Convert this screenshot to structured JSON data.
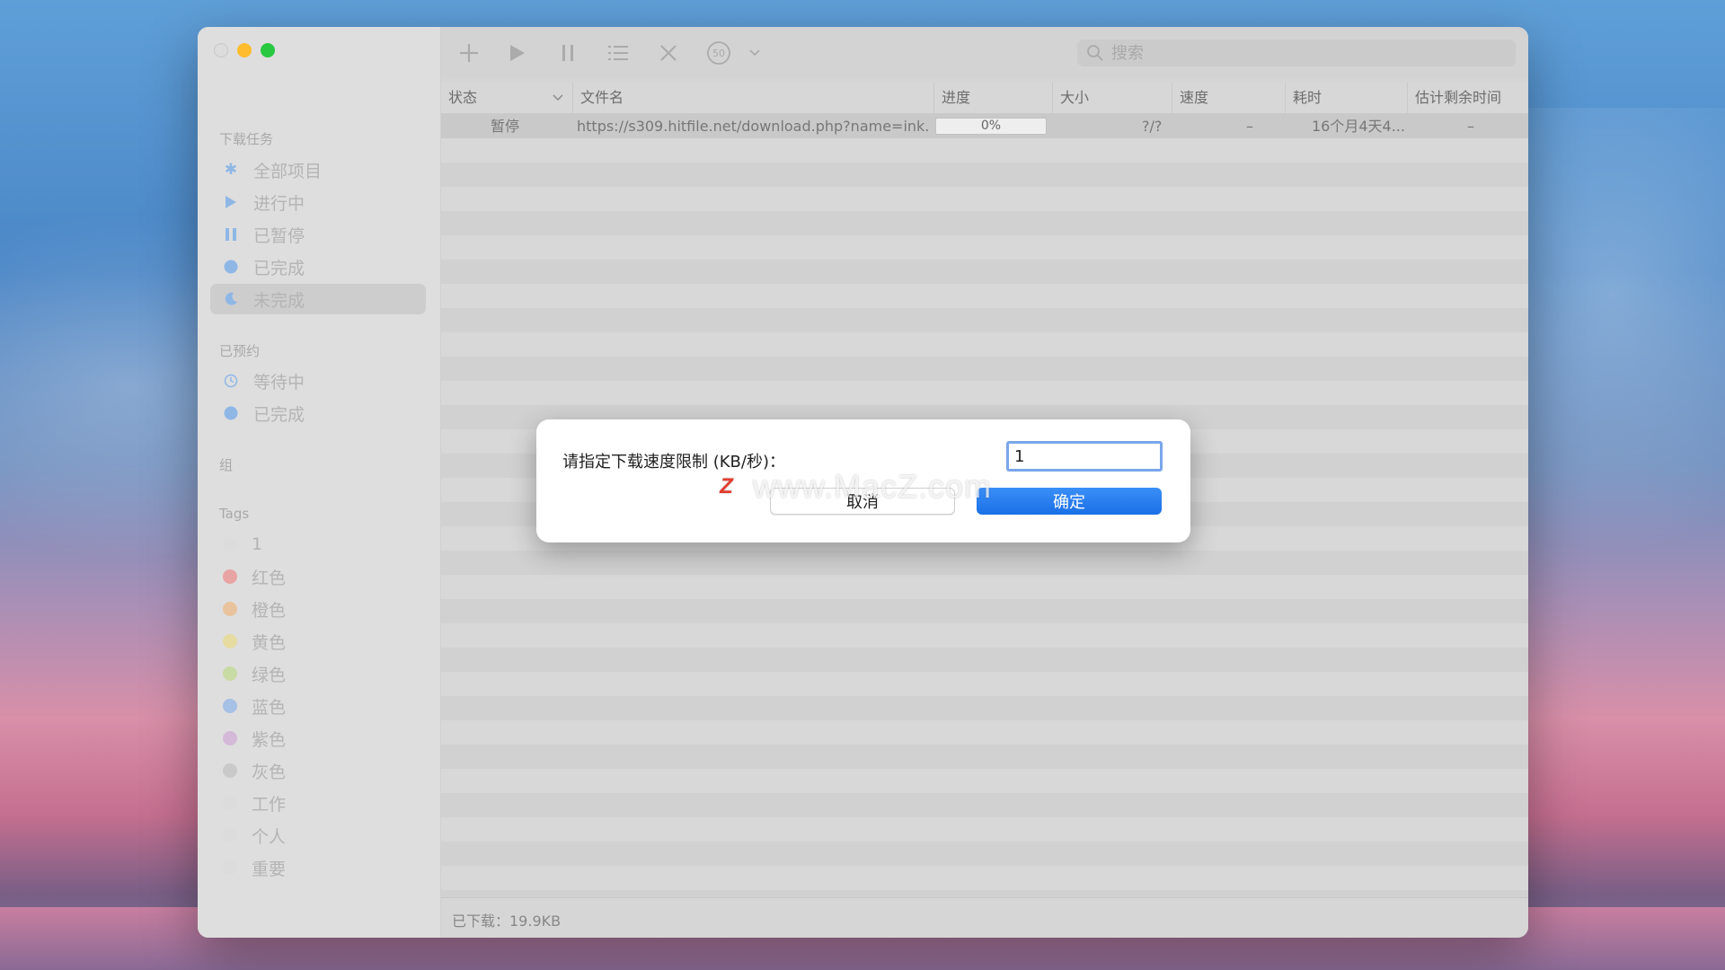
{
  "window": {
    "traffic_lights": [
      "close",
      "minimize",
      "maximize"
    ]
  },
  "sidebar": {
    "downloads": {
      "title": "下载任务",
      "items": [
        {
          "label": "全部项目",
          "icon": "asterisk-icon",
          "color": "#8fb7e6"
        },
        {
          "label": "进行中",
          "icon": "play-icon",
          "color": "#8fb7e6"
        },
        {
          "label": "已暂停",
          "icon": "pause-icon",
          "color": "#8fb7e6"
        },
        {
          "label": "已完成",
          "icon": "circle-icon",
          "color": "#8fb7e6"
        },
        {
          "label": "未完成",
          "icon": "moon-icon",
          "color": "#8fb7e6"
        }
      ]
    },
    "scheduled": {
      "title": "已预约",
      "items": [
        {
          "label": "等待中",
          "icon": "clock-icon",
          "color": "#8fb7e6"
        },
        {
          "label": "已完成",
          "icon": "circle-icon",
          "color": "#8fb7e6"
        }
      ]
    },
    "groups": {
      "title": "组"
    },
    "tags": {
      "title": "Tags",
      "items": [
        {
          "label": "1",
          "color": "#dcdcdc"
        },
        {
          "label": "红色",
          "color": "#e8a3a3"
        },
        {
          "label": "橙色",
          "color": "#e8c39d"
        },
        {
          "label": "黄色",
          "color": "#e6dba0"
        },
        {
          "label": "绿色",
          "color": "#c9dba4"
        },
        {
          "label": "蓝色",
          "color": "#a6c0e6"
        },
        {
          "label": "紫色",
          "color": "#d4b9d8"
        },
        {
          "label": "灰色",
          "color": "#c9c9c9"
        },
        {
          "label": "工作",
          "color": "#dcdcdc"
        },
        {
          "label": "个人",
          "color": "#dcdcdc"
        },
        {
          "label": "重要",
          "color": "#dcdcdc"
        }
      ]
    }
  },
  "toolbar": {
    "icons": [
      "add-icon",
      "play-icon",
      "pause-icon",
      "list-icon",
      "close-icon",
      "speed-limit-icon",
      "chevron-down-icon"
    ],
    "speed_badge": "50",
    "search_placeholder": "搜索"
  },
  "table": {
    "headers": [
      "状态",
      "文件名",
      "进度",
      "大小",
      "速度",
      "耗时",
      "估计剩余时间"
    ],
    "rows": [
      {
        "status": "暂停",
        "filename": "https://s309.hitfile.net/download.php?name=ink...",
        "progress": "0%",
        "size": "?/?",
        "speed": "–",
        "elapsed": "16个月4天4...",
        "remaining": "–"
      }
    ]
  },
  "statusbar": {
    "downloaded": "已下载：19.9KB"
  },
  "dialog": {
    "prompt": "请指定下载速度限制 (KB/秒)：",
    "value": "1",
    "cancel": "取消",
    "ok": "确定"
  },
  "watermark": {
    "badge": "Z",
    "text": "www.MacZ.com"
  },
  "colors": {
    "accent": "#1a6fe6",
    "min": "#febc2e",
    "max": "#28c840"
  }
}
